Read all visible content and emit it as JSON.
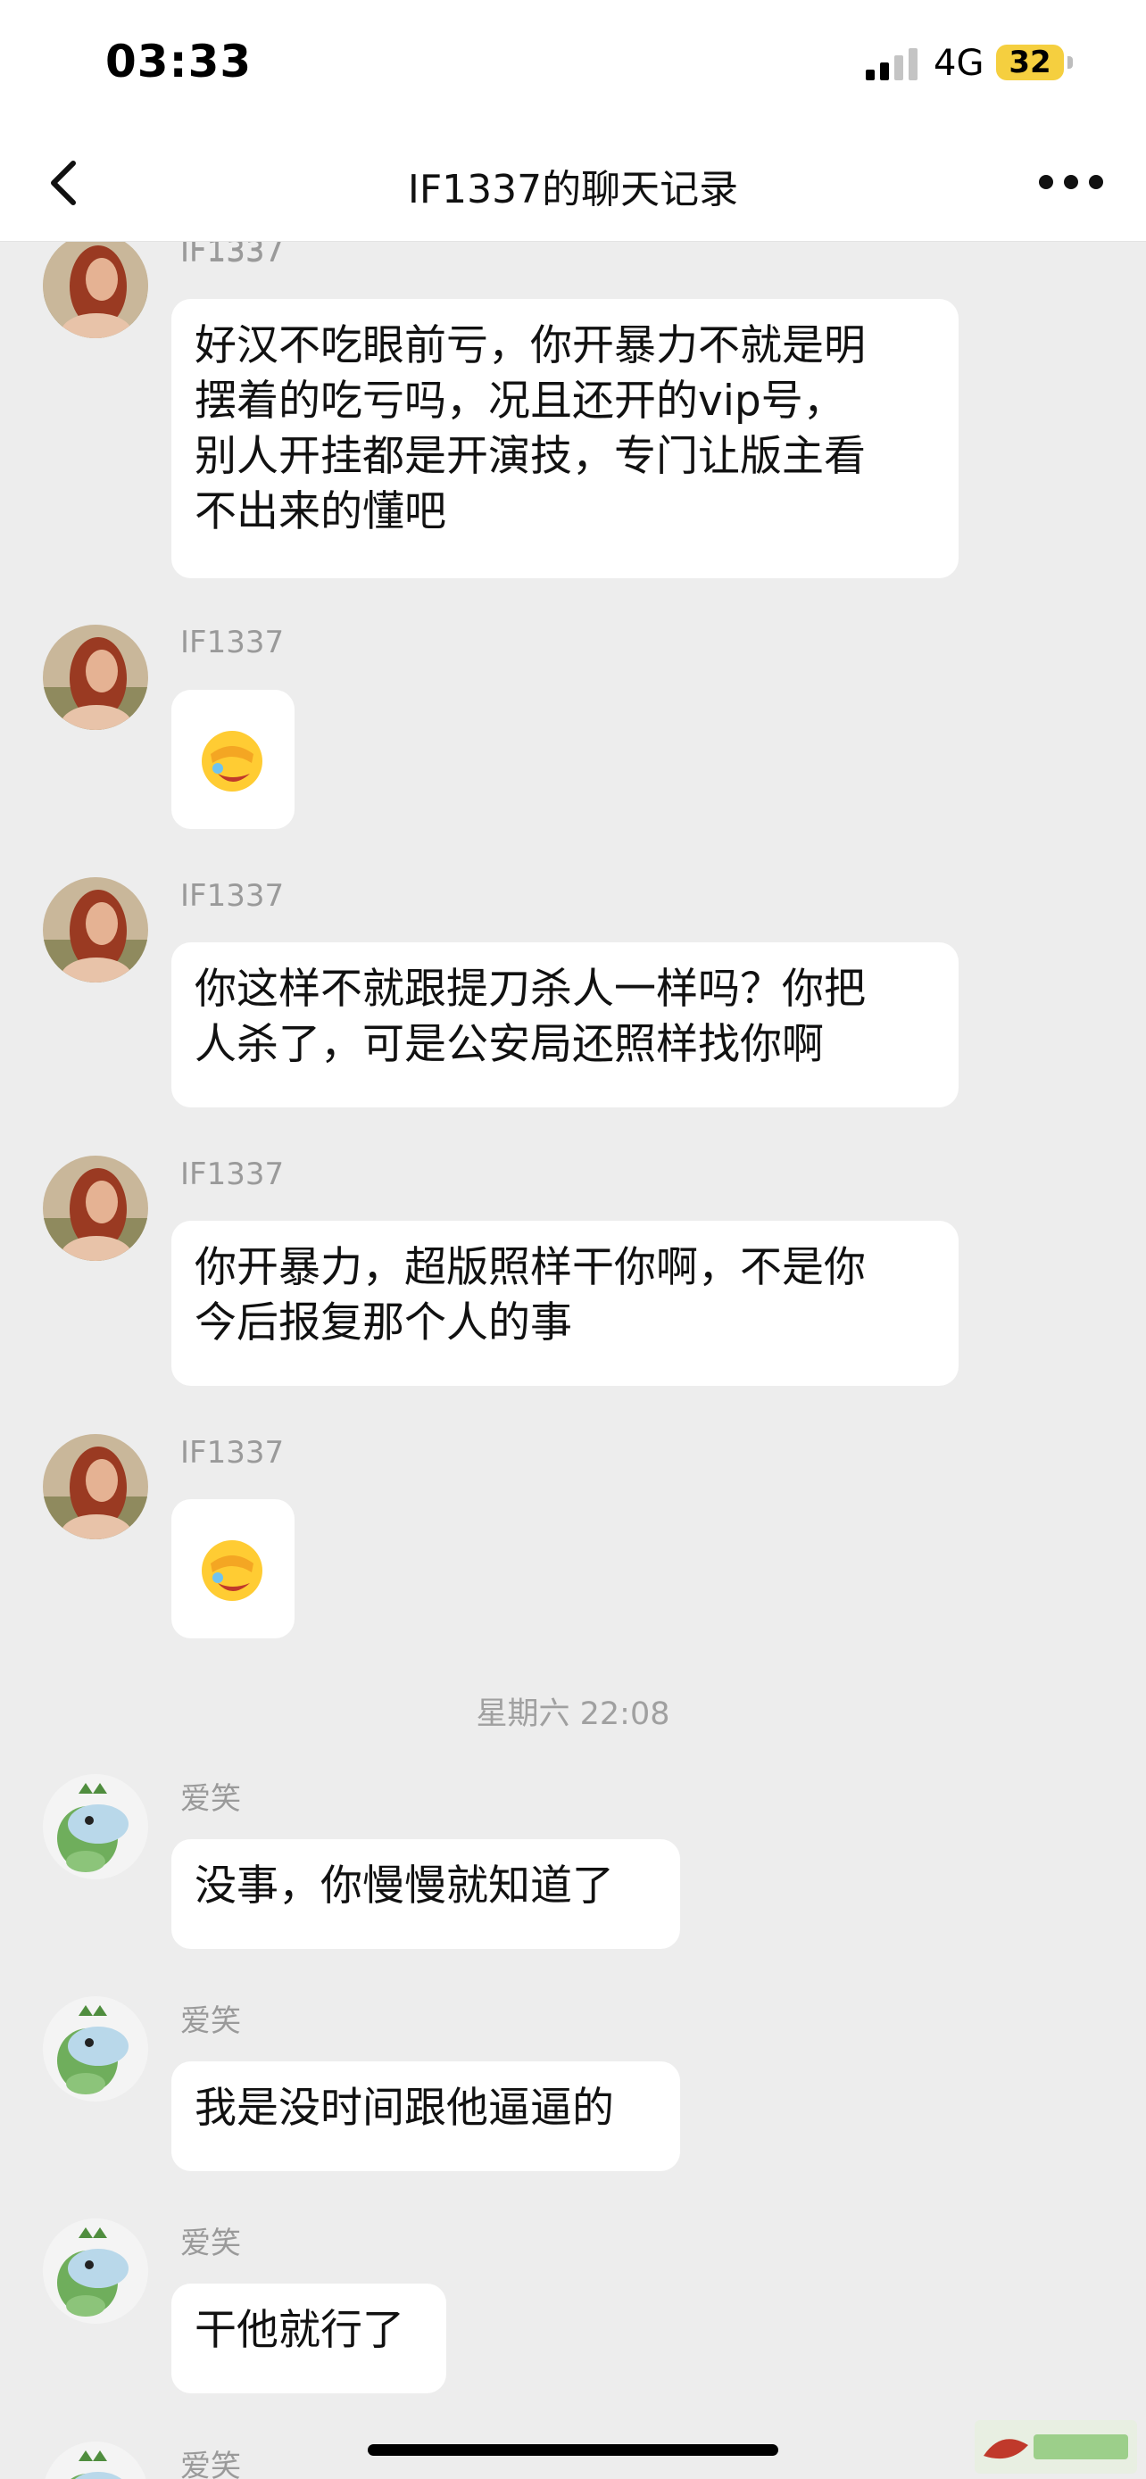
{
  "status_bar": {
    "time": "03:33",
    "network": "4G",
    "battery": "32",
    "battery_color": "#f5cf3f"
  },
  "header": {
    "title": "IF1337的聊天记录",
    "back_icon": "chevron-left-icon",
    "more_icon": "ellipsis-icon"
  },
  "messages": [
    {
      "sender": "IF1337",
      "type": "text",
      "lines": [
        "好汉不吃眼前亏，你开暴力不就是明",
        "摆着的吃亏吗，况且还开的vip号，",
        "别人开挂都是开演技，专门让版主看",
        "不出来的懂吧"
      ]
    },
    {
      "sender": "IF1337",
      "type": "emoji",
      "emoji": "facepalm-emoji"
    },
    {
      "sender": "IF1337",
      "type": "text",
      "lines": [
        "你这样不就跟提刀杀人一样吗？你把",
        "人杀了，可是公安局还照样找你啊"
      ]
    },
    {
      "sender": "IF1337",
      "type": "text",
      "lines": [
        "你开暴力，超版照样干你啊，不是你",
        "今后报复那个人的事"
      ]
    },
    {
      "sender": "IF1337",
      "type": "emoji",
      "emoji": "facepalm-emoji"
    },
    {
      "type": "timestamp",
      "text": "星期六 22:08"
    },
    {
      "sender": "爱笑",
      "type": "text",
      "lines": [
        "没事，你慢慢就知道了"
      ]
    },
    {
      "sender": "爱笑",
      "type": "text",
      "lines": [
        "我是没时间跟他逼逼的"
      ]
    },
    {
      "sender": "爱笑",
      "type": "text",
      "lines": [
        "干他就行了"
      ]
    },
    {
      "sender": "爱笑",
      "type": "partial"
    }
  ],
  "colors": {
    "background": "#ededed",
    "bubble": "#ffffff",
    "sender_name": "#9a9a9a"
  }
}
